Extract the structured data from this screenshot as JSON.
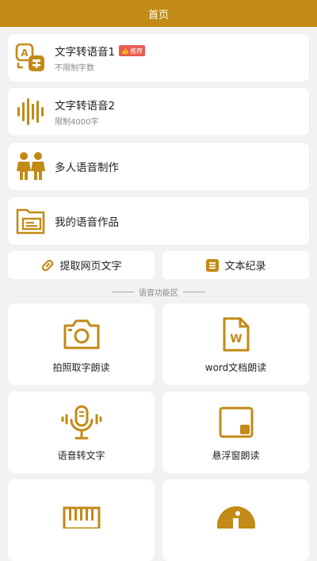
{
  "header": {
    "title": "首页"
  },
  "colors": {
    "accent": "#c28a16",
    "badge": "#e85a4f"
  },
  "features": [
    {
      "label": "文字转语音1",
      "sub": "不限制字数",
      "badge": "推荐",
      "icon": "text-to-speech-icon"
    },
    {
      "label": "文字转语音2",
      "sub": "限制4000字",
      "icon": "sound-wave-icon"
    },
    {
      "label": "多人语音制作",
      "icon": "people-icon"
    },
    {
      "label": "我的语音作品",
      "icon": "folder-icon"
    }
  ],
  "quick_actions": [
    {
      "label": "提取网页文字",
      "icon": "link-icon"
    },
    {
      "label": "文本纪录",
      "icon": "notes-icon"
    }
  ],
  "section_title": "语音功能区",
  "tools": [
    {
      "label": "拍照取字朗读",
      "icon": "camera-icon"
    },
    {
      "label": "word文档朗读",
      "icon": "word-doc-icon"
    },
    {
      "label": "语音转文字",
      "icon": "microphone-icon"
    },
    {
      "label": "悬浮窗朗读",
      "icon": "floating-window-icon"
    },
    {
      "label": "",
      "icon": "piano-icon"
    },
    {
      "label": "",
      "icon": "info-icon"
    }
  ]
}
